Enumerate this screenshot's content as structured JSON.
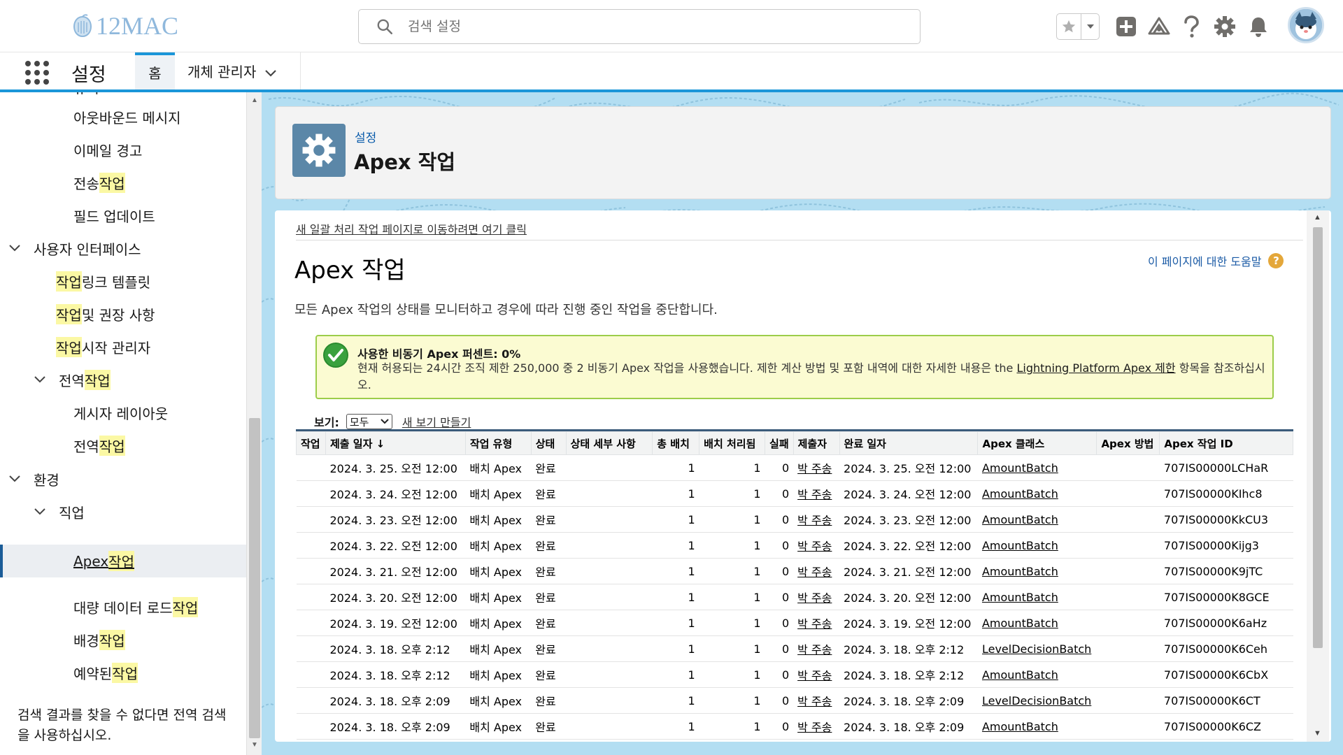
{
  "header": {
    "logo_text": "12MAC",
    "search_placeholder": "검색 설정"
  },
  "nav": {
    "app_name": "설정",
    "tab_home": "홈",
    "tab_object_manager": "개체 관리자"
  },
  "sidebar": {
    "items": [
      {
        "label": "규칙",
        "level": 2
      },
      {
        "label": "아웃바운드 메시지",
        "level": 2
      },
      {
        "label": "이메일 경고",
        "level": 2
      },
      {
        "label_pre": "전송 ",
        "label_hl": "작업",
        "level": 2
      },
      {
        "label": "필드 업데이트",
        "level": 2
      },
      {
        "label": "사용자 인터페이스",
        "level": 0
      },
      {
        "label_hl": "작업",
        "label_post": " 링크 템플릿",
        "level": 1
      },
      {
        "label_hl": "작업",
        "label_post": " 및 권장 사항",
        "level": 1
      },
      {
        "label_hl": "작업",
        "label_post": " 시작 관리자",
        "level": 1
      },
      {
        "label_pre": "전역 ",
        "label_hl": "작업",
        "level": 1
      },
      {
        "label": "게시자 레이아웃",
        "level": 2
      },
      {
        "label_pre": "전역 ",
        "label_hl": "작업",
        "level": 2
      },
      {
        "label": "환경",
        "level": 0
      },
      {
        "label": "직업",
        "level": 1
      },
      {
        "label_pre": "Apex ",
        "label_hl": "작업",
        "level": 2
      },
      {
        "label_pre": "대량 데이터 로드 ",
        "label_hl": "작업",
        "level": 2
      },
      {
        "label_pre": "배경 ",
        "label_hl": "작업",
        "level": 2
      },
      {
        "label_pre": "예약된 ",
        "label_hl": "작업",
        "level": 2
      }
    ],
    "footer": "검색 결과를 찾을 수 없다면 전역 검색을 사용하십시오."
  },
  "page_header": {
    "breadcrumb": "설정",
    "title": "Apex 작업"
  },
  "content": {
    "new_page_link": "새 일괄 처리 작업 페이지로 이동하려면 여기 클릭",
    "title": "Apex 작업",
    "help_link": "이 페이지에 대한 도움말",
    "description": "모든 Apex 작업의 상태를 모니터하고 경우에 따라 진행 중인 작업을 중단합니다.",
    "notice_title": "사용한 비동기 Apex 퍼센트: 0%",
    "notice_body_pre": "현재 허용되는 24시간 조직 제한 250,000 중 2 비동기 Apex 작업을 사용했습니다. 제한 계산 방법 및 포함 내역에 대한 자세한 내용은 the ",
    "notice_link": "Lightning Platform Apex 제한",
    "notice_body_post": " 항목을 참조하십시오.",
    "view_label": "보기:",
    "view_selected": "모두",
    "create_view": "새 보기 만들기"
  },
  "table": {
    "headers": [
      "작업",
      "제출 일자 ↓",
      "작업 유형",
      "상태",
      "상태 세부 사항",
      "총 배치",
      "배치 처리됨",
      "실패",
      "제출자",
      "완료 일자",
      "Apex 클래스",
      "Apex 방법",
      "Apex 작업 ID"
    ],
    "rows": [
      [
        "",
        "2024. 3. 25. 오전 12:00",
        "배치 Apex",
        "완료",
        "",
        "1",
        "1",
        "0",
        "박 주송",
        "2024. 3. 25. 오전 12:00",
        "AmountBatch",
        "",
        "707IS00000LCHaR"
      ],
      [
        "",
        "2024. 3. 24. 오전 12:00",
        "배치 Apex",
        "완료",
        "",
        "1",
        "1",
        "0",
        "박 주송",
        "2024. 3. 24. 오전 12:00",
        "AmountBatch",
        "",
        "707IS00000KIhc8"
      ],
      [
        "",
        "2024. 3. 23. 오전 12:00",
        "배치 Apex",
        "완료",
        "",
        "1",
        "1",
        "0",
        "박 주송",
        "2024. 3. 23. 오전 12:00",
        "AmountBatch",
        "",
        "707IS00000KkCU3"
      ],
      [
        "",
        "2024. 3. 22. 오전 12:00",
        "배치 Apex",
        "완료",
        "",
        "1",
        "1",
        "0",
        "박 주송",
        "2024. 3. 22. 오전 12:00",
        "AmountBatch",
        "",
        "707IS00000Kijg3"
      ],
      [
        "",
        "2024. 3. 21. 오전 12:00",
        "배치 Apex",
        "완료",
        "",
        "1",
        "1",
        "0",
        "박 주송",
        "2024. 3. 21. 오전 12:00",
        "AmountBatch",
        "",
        "707IS00000K9jTC"
      ],
      [
        "",
        "2024. 3. 20. 오전 12:00",
        "배치 Apex",
        "완료",
        "",
        "1",
        "1",
        "0",
        "박 주송",
        "2024. 3. 20. 오전 12:00",
        "AmountBatch",
        "",
        "707IS00000K8GCE"
      ],
      [
        "",
        "2024. 3. 19. 오전 12:00",
        "배치 Apex",
        "완료",
        "",
        "1",
        "1",
        "0",
        "박 주송",
        "2024. 3. 19. 오전 12:00",
        "AmountBatch",
        "",
        "707IS00000K6aHz"
      ],
      [
        "",
        "2024. 3. 18. 오후 2:12",
        "배치 Apex",
        "완료",
        "",
        "1",
        "1",
        "0",
        "박 주송",
        "2024. 3. 18. 오후 2:12",
        "LevelDecisionBatch",
        "",
        "707IS00000K6Ceh"
      ],
      [
        "",
        "2024. 3. 18. 오후 2:12",
        "배치 Apex",
        "완료",
        "",
        "1",
        "1",
        "0",
        "박 주송",
        "2024. 3. 18. 오후 2:12",
        "AmountBatch",
        "",
        "707IS00000K6CbX"
      ],
      [
        "",
        "2024. 3. 18. 오후 2:09",
        "배치 Apex",
        "완료",
        "",
        "1",
        "1",
        "0",
        "박 주송",
        "2024. 3. 18. 오후 2:09",
        "LevelDecisionBatch",
        "",
        "707IS00000K6CT"
      ],
      [
        "",
        "2024. 3. 18. 오후 2:09",
        "배치 Apex",
        "완료",
        "",
        "1",
        "1",
        "0",
        "박 주송",
        "2024. 3. 18. 오후 2:09",
        "AmountBatch",
        "",
        "707IS00000K6CZ"
      ]
    ]
  },
  "colors": {
    "brand_blue": "#1b96d9",
    "highlight": "#fbf8a4",
    "notice_bg": "#fbfbd2",
    "notice_border": "#9ccd4a",
    "gear_tile": "#5b87a8"
  }
}
